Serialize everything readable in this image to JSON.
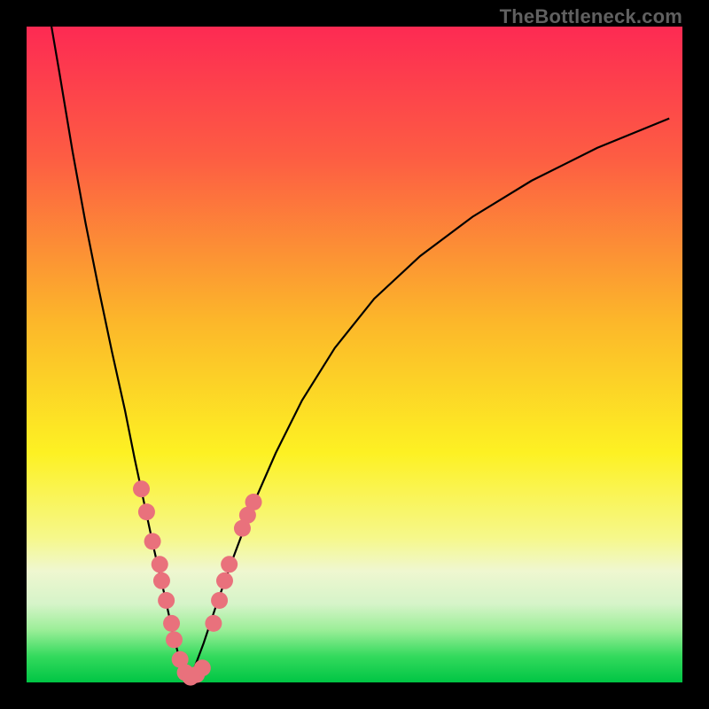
{
  "watermark": "TheBottleneck.com",
  "colors": {
    "frame": "#000000",
    "gradient_stops": [
      {
        "pct": 0,
        "color": "#fd2a53"
      },
      {
        "pct": 20,
        "color": "#fd5d43"
      },
      {
        "pct": 45,
        "color": "#fcb72a"
      },
      {
        "pct": 65,
        "color": "#fdf123"
      },
      {
        "pct": 78,
        "color": "#f6f88b"
      },
      {
        "pct": 83,
        "color": "#eff7d0"
      },
      {
        "pct": 88,
        "color": "#d6f4c9"
      },
      {
        "pct": 92,
        "color": "#9bee98"
      },
      {
        "pct": 96,
        "color": "#34da5d"
      },
      {
        "pct": 100,
        "color": "#00c544"
      }
    ],
    "curve": "#000000",
    "marker": "#e9717c"
  },
  "chart_data": {
    "type": "line",
    "title": "",
    "xlabel": "",
    "ylabel": "",
    "xlim": [
      0,
      100
    ],
    "ylim": [
      0,
      100
    ],
    "series": [
      {
        "name": "left-branch",
        "x": [
          3.8,
          5,
          7,
          9,
          11,
          13,
          15,
          16.5,
          18,
          19.5,
          21,
          22.2,
          23.2,
          24,
          24.5
        ],
        "values": [
          100,
          93,
          81,
          70,
          60,
          50.5,
          41.5,
          34,
          27,
          20,
          13.5,
          8,
          4,
          1.5,
          0.5
        ]
      },
      {
        "name": "right-branch",
        "x": [
          24.5,
          25.5,
          27,
          29,
          31.5,
          34.5,
          38,
          42,
          47,
          53,
          60,
          68,
          77,
          87,
          98
        ],
        "values": [
          0.5,
          2,
          6,
          12,
          19,
          27,
          35,
          43,
          51,
          58.5,
          65,
          71,
          76.5,
          81.5,
          86
        ]
      }
    ],
    "markers": {
      "name": "pink-data-points",
      "points": [
        {
          "x": 17.5,
          "y": 29.5
        },
        {
          "x": 18.3,
          "y": 26.0
        },
        {
          "x": 19.2,
          "y": 21.5
        },
        {
          "x": 20.3,
          "y": 18.0
        },
        {
          "x": 20.6,
          "y": 15.5
        },
        {
          "x": 21.3,
          "y": 12.5
        },
        {
          "x": 22.1,
          "y": 9.0
        },
        {
          "x": 22.5,
          "y": 6.5
        },
        {
          "x": 23.4,
          "y": 3.5
        },
        {
          "x": 24.2,
          "y": 1.5
        },
        {
          "x": 25.0,
          "y": 0.8
        },
        {
          "x": 25.9,
          "y": 1.2
        },
        {
          "x": 26.8,
          "y": 2.2
        },
        {
          "x": 28.5,
          "y": 9.0
        },
        {
          "x": 29.4,
          "y": 12.5
        },
        {
          "x": 30.2,
          "y": 15.5
        },
        {
          "x": 30.9,
          "y": 18.0
        },
        {
          "x": 32.9,
          "y": 23.5
        },
        {
          "x": 33.7,
          "y": 25.5
        },
        {
          "x": 34.6,
          "y": 27.5
        }
      ]
    }
  }
}
